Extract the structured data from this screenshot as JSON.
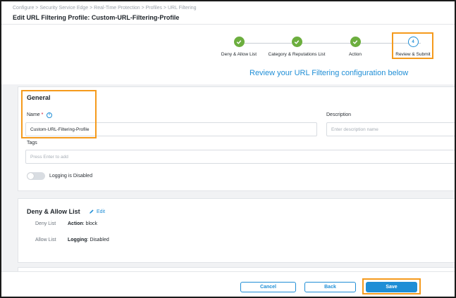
{
  "header": {
    "breadcrumb": "Configure > Security Service Edge > Real-Time Protection > Profiles > URL Filtering",
    "title": "Edit URL Filtering Profile: Custom-URL-Filtering-Profile"
  },
  "stepper": {
    "steps": [
      {
        "label": "Deny & Allow List",
        "status": "complete"
      },
      {
        "label": "Category & Reputations List",
        "status": "complete"
      },
      {
        "label": "Action",
        "status": "complete"
      },
      {
        "label": "Review & Submit",
        "status": "current",
        "number": "4"
      }
    ],
    "heading": "Review your URL Filtering configuration below"
  },
  "general": {
    "title": "General",
    "name_label": "Name",
    "name_required": "*",
    "name_value": "Custom-URL-Filtering-Profile",
    "description_label": "Description",
    "description_placeholder": "Enter description name",
    "tags_label": "Tags",
    "tags_placeholder": "Press Enter to add",
    "logging_label": "Logging is Disabled"
  },
  "deny_allow": {
    "title": "Deny & Allow List",
    "edit_label": "Edit",
    "deny_label": "Deny List",
    "deny_key": "Action",
    "deny_value": ": block",
    "allow_label": "Allow List",
    "allow_key": "Logging",
    "allow_value": ": Disabled"
  },
  "footer": {
    "cancel_label": "Cancel",
    "back_label": "Back",
    "save_label": "Save"
  },
  "colors": {
    "accent": "#1f8ed6",
    "success": "#6cae3e",
    "highlight": "#f59a1c"
  },
  "icons": {
    "step_complete": "checkmark-icon",
    "info": "info-icon",
    "edit": "pencil-icon"
  }
}
